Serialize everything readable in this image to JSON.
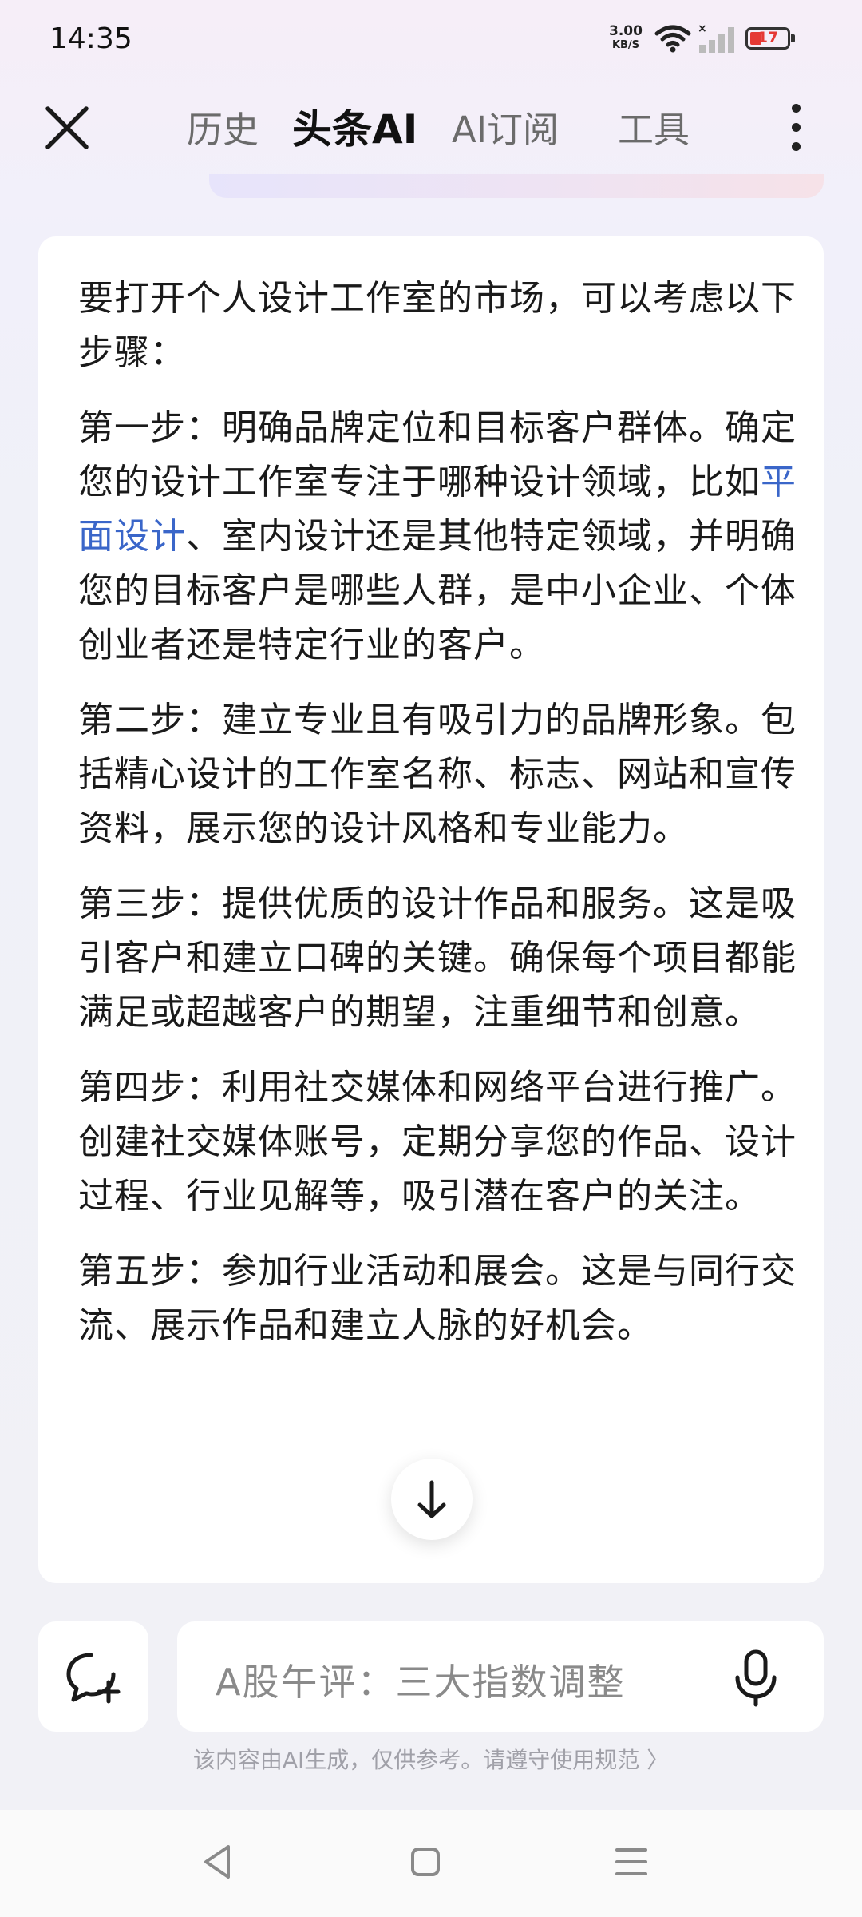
{
  "status_bar": {
    "time": "14:35",
    "net_speed": "3.00",
    "net_unit": "KB/S",
    "battery": "17"
  },
  "nav": {
    "tabs": [
      {
        "label": "历史"
      },
      {
        "label": "头条AI"
      },
      {
        "label": "AI订阅"
      },
      {
        "label": "工具"
      }
    ],
    "active_tab": "头条AI"
  },
  "content": {
    "intro": "要打开个人设计工作室的市场，可以考虑以下步骤：",
    "step1_pre": "第一步：明确品牌定位和目标客户群体。确定您的设计工作室专注于哪种设计领域，比如",
    "step1_link": "平面设计",
    "step1_post": "、室内设计还是其他特定领域，并明确您的目标客户是哪些人群，是中小企业、个体创业者还是特定行业的客户。",
    "step2": "第二步：建立专业且有吸引力的品牌形象。包括精心设计的工作室名称、标志、网站和宣传资料，展示您的设计风格和专业能力。",
    "step3": "第三步：提供优质的设计作品和服务。这是吸引客户和建立口碑的关键。确保每个项目都能满足或超越客户的期望，注重细节和创意。",
    "step4": "第四步：利用社交媒体和网络平台进行推广。创建社交媒体账号，定期分享您的作品、设计过程、行业见解等，吸引潜在客户的关注。",
    "step5": "第五步：参加行业活动和展会。这是与同行交流、展示作品和建立人脉的好机会。"
  },
  "input": {
    "placeholder": "A股午评：三大指数调整"
  },
  "disclaimer": "该内容由AI生成，仅供参考。请遵守使用规范 〉",
  "icons": {
    "close": "close-icon",
    "more": "more-vertical-icon",
    "scroll_down": "arrow-down-icon",
    "new_chat": "new-chat-icon",
    "mic": "microphone-icon",
    "back": "back-triangle-icon",
    "home": "home-square-icon",
    "recents": "menu-lines-icon"
  },
  "colors": {
    "link": "#3a66c9",
    "battery_low": "#e53935"
  }
}
